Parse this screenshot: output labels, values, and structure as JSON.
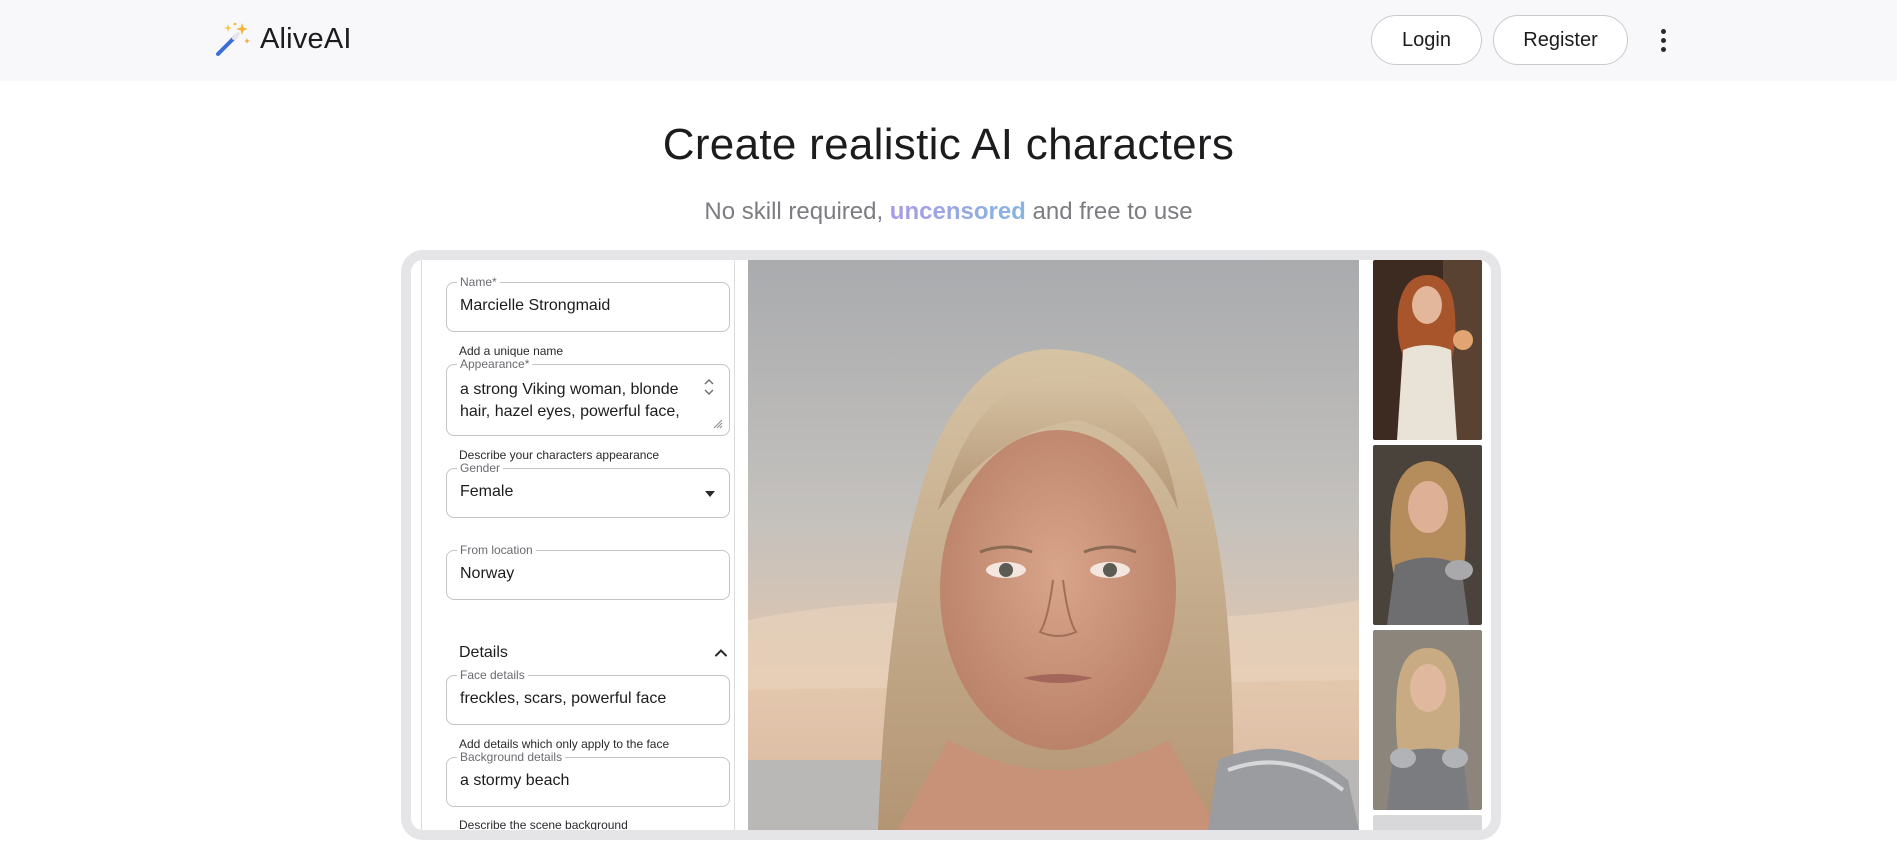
{
  "header": {
    "brand": "AliveAI",
    "login_label": "Login",
    "register_label": "Register"
  },
  "hero": {
    "title": "Create realistic AI characters",
    "subtitle_before": "No skill required, ",
    "subtitle_accent": "uncensored",
    "subtitle_after": " and free to use"
  },
  "form": {
    "name": {
      "label": "Name*",
      "value": "Marcielle Strongmaid",
      "helper": "Add a unique name"
    },
    "appearance": {
      "label": "Appearance*",
      "value": "a strong Viking woman, blonde hair, hazel eyes, powerful face,",
      "helper": "Describe your characters appearance"
    },
    "gender": {
      "label": "Gender",
      "value": "Female"
    },
    "location": {
      "label": "From location",
      "value": "Norway"
    },
    "details": {
      "label": "Details"
    },
    "face": {
      "label": "Face details",
      "value": "freckles, scars, powerful face",
      "helper": "Add details which only apply to the face"
    },
    "background": {
      "label": "Background details",
      "value": "a stormy beach",
      "helper": "Describe the scene background"
    }
  },
  "colors": {
    "header_bg": "#f8f8fb",
    "accent_start": "#a99be6",
    "accent_end": "#86b6df",
    "frame": "#e5e5e7"
  },
  "icons": {
    "brand": "magic-wand-icon",
    "menu": "more-vertical-icon",
    "select": "caret-down-icon",
    "details": "chevron-up-icon"
  }
}
